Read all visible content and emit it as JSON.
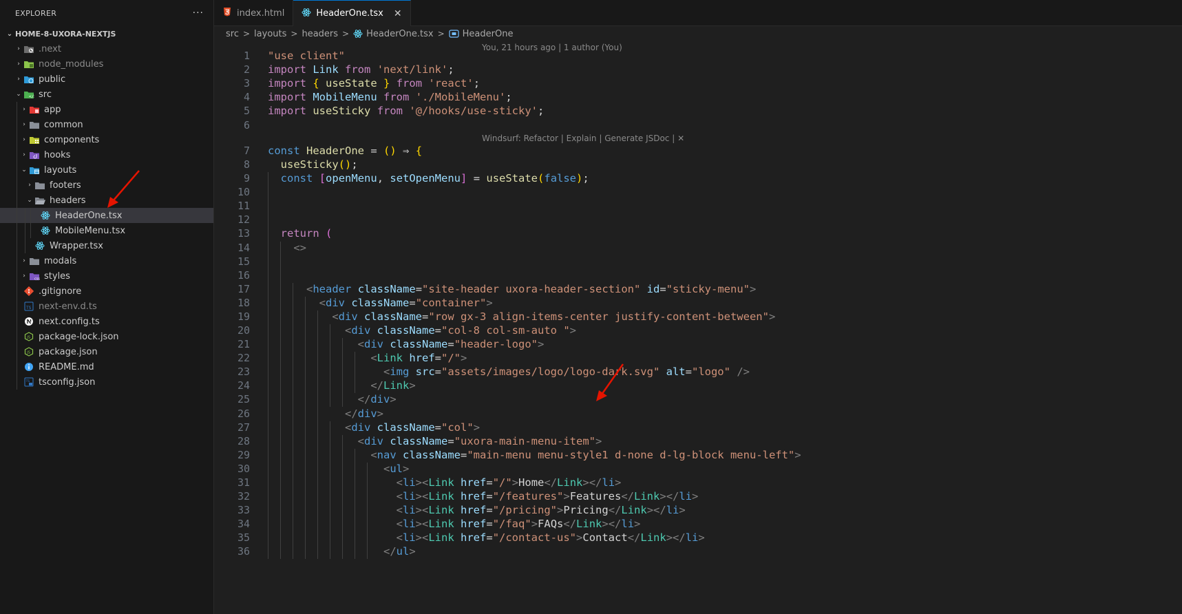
{
  "sidebar": {
    "title": "EXPLORER",
    "more": "···",
    "root": "HOME-8-UXORA-NEXTJS",
    "items": [
      {
        "label": ".next",
        "icon": "next-folder-icon"
      },
      {
        "label": "node_modules",
        "icon": "node-folder-icon"
      },
      {
        "label": "public",
        "icon": "public-folder-icon"
      },
      {
        "label": "src",
        "icon": "src-folder-icon"
      },
      {
        "label": "app",
        "icon": "app-folder-icon"
      },
      {
        "label": "common",
        "icon": "folder-icon"
      },
      {
        "label": "components",
        "icon": "components-folder-icon"
      },
      {
        "label": "hooks",
        "icon": "hooks-folder-icon"
      },
      {
        "label": "layouts",
        "icon": "layouts-folder-icon"
      },
      {
        "label": "footers",
        "icon": "folder-icon"
      },
      {
        "label": "headers",
        "icon": "folder-open-icon"
      },
      {
        "label": "HeaderOne.tsx",
        "icon": "react-icon"
      },
      {
        "label": "MobileMenu.tsx",
        "icon": "react-icon"
      },
      {
        "label": "Wrapper.tsx",
        "icon": "react-icon"
      },
      {
        "label": "modals",
        "icon": "folder-icon"
      },
      {
        "label": "styles",
        "icon": "css-folder-icon"
      },
      {
        "label": ".gitignore",
        "icon": "git-icon"
      },
      {
        "label": "next-env.d.ts",
        "icon": "ts-icon"
      },
      {
        "label": "next.config.ts",
        "icon": "next-icon"
      },
      {
        "label": "package-lock.json",
        "icon": "node-icon"
      },
      {
        "label": "package.json",
        "icon": "node-icon"
      },
      {
        "label": "README.md",
        "icon": "info-icon"
      },
      {
        "label": "tsconfig.json",
        "icon": "tsconfig-icon"
      }
    ]
  },
  "tabs": [
    {
      "label": "index.html",
      "icon": "html-icon"
    },
    {
      "label": "HeaderOne.tsx",
      "icon": "react-icon",
      "close": "✕"
    }
  ],
  "breadcrumb": {
    "items": [
      "src",
      "layouts",
      "headers",
      "HeaderOne.tsx",
      "HeaderOne"
    ],
    "separator": ">"
  },
  "editor": {
    "blame": "You, 21 hours ago | 1 author (You)",
    "codelens": "Windsurf: Refactor | Explain | Generate JSDoc | ✕",
    "line_numbers": [
      "1",
      "2",
      "3",
      "4",
      "5",
      "6",
      "7",
      "8",
      "9",
      "10",
      "11",
      "12",
      "13",
      "14",
      "15",
      "16",
      "17",
      "18",
      "19",
      "20",
      "21",
      "22",
      "23",
      "24",
      "25",
      "26",
      "27",
      "28",
      "29",
      "30",
      "31",
      "32",
      "33",
      "34",
      "35",
      "36"
    ],
    "lines": [
      "\"use client\"",
      "import Link from 'next/link';",
      "import { useState } from 'react';",
      "import MobileMenu from './MobileMenu';",
      "import useSticky from '@/hooks/use-sticky';",
      "",
      "const HeaderOne = () ⇒ {",
      "  useSticky();",
      "  const [openMenu, setOpenMenu] = useState(false);",
      "",
      "",
      "",
      "  return (",
      "    <>",
      "",
      "",
      "      <header className=\"site-header uxora-header-section\" id=\"sticky-menu\">",
      "        <div className=\"container\">",
      "          <div className=\"row gx-3 align-items-center justify-content-between\">",
      "            <div className=\"col-8 col-sm-auto \">",
      "              <div className=\"header-logo\">",
      "                <Link href=\"/\">",
      "                  <img src=\"assets/images/logo/logo-dark.svg\" alt=\"logo\" />",
      "                </Link>",
      "              </div>",
      "            </div>",
      "            <div className=\"col\">",
      "              <div className=\"uxora-main-menu-item\">",
      "                <nav className=\"main-menu menu-style1 d-none d-lg-block menu-left\">",
      "                  <ul>",
      "                    <li><Link href=\"/\">Home</Link></li>",
      "                    <li><Link href=\"/features\">Features</Link></li>",
      "                    <li><Link href=\"/pricing\">Pricing</Link></li>",
      "                    <li><Link href=\"/faq\">FAQs</Link></li>",
      "                    <li><Link href=\"/contact-us\">Contact</Link></li>",
      "                  </ul>"
    ]
  },
  "colors": {
    "accent": "#0078d4",
    "annotation_arrow": "#e51400"
  }
}
